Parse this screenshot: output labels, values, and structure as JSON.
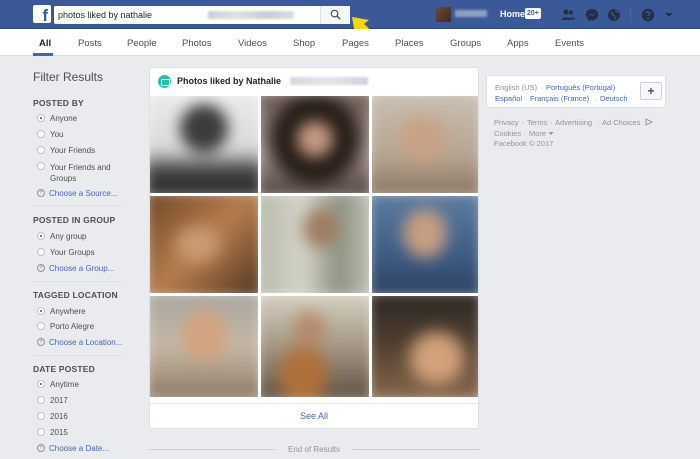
{
  "header": {
    "logo": "f",
    "search_value": "photos liked by nathalie",
    "home_label": "Home",
    "home_badge": "20+"
  },
  "tabs": [
    {
      "label": "All",
      "active": true
    },
    {
      "label": "Posts"
    },
    {
      "label": "People"
    },
    {
      "label": "Photos"
    },
    {
      "label": "Videos"
    },
    {
      "label": "Shop"
    },
    {
      "label": "Pages"
    },
    {
      "label": "Places"
    },
    {
      "label": "Groups"
    },
    {
      "label": "Apps"
    },
    {
      "label": "Events"
    }
  ],
  "filters": {
    "title": "Filter Results",
    "posted_by": {
      "title": "POSTED BY",
      "options": [
        "Anyone",
        "You",
        "Your Friends",
        "Your Friends and Groups"
      ],
      "choose": "Choose a Source..."
    },
    "posted_in_group": {
      "title": "POSTED IN GROUP",
      "options": [
        "Any group",
        "Your Groups"
      ],
      "choose": "Choose a Group..."
    },
    "tagged_location": {
      "title": "TAGGED LOCATION",
      "options": [
        "Anywhere",
        "Porto Alegre"
      ],
      "choose": "Choose a Location..."
    },
    "date_posted": {
      "title": "DATE POSTED",
      "options": [
        "Anytime",
        "2017",
        "2016",
        "2015"
      ],
      "choose": "Choose a Date..."
    }
  },
  "results": {
    "title": "Photos liked by Nathalie",
    "see_all": "See All",
    "end": "End of Results"
  },
  "languages": {
    "current": "English (US)",
    "links": [
      "Português (Portugal)",
      "Español",
      "Français (France)",
      "Deutsch"
    ],
    "add": "+"
  },
  "footer": {
    "links": [
      "Privacy",
      "Terms",
      "Advertising",
      "Ad Choices",
      "Cookies",
      "More"
    ],
    "copyright": "Facebook © 2017"
  },
  "colors": {
    "brand": "#3b5998",
    "link": "#4267b2",
    "arrow": "#f5d80a",
    "background": "#e9ebee"
  }
}
